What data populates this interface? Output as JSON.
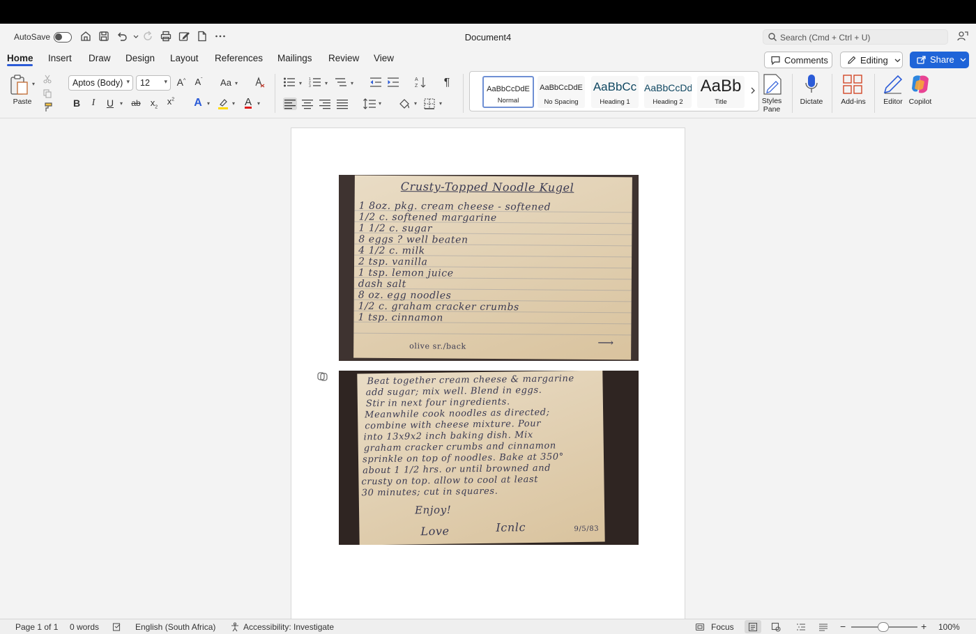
{
  "titlebar": {
    "autosave_label": "AutoSave",
    "autosave_on": false,
    "document_title": "Document4",
    "search_placeholder": "Search (Cmd + Ctrl + U)"
  },
  "tabs": [
    "Home",
    "Insert",
    "Draw",
    "Design",
    "Layout",
    "References",
    "Mailings",
    "Review",
    "View"
  ],
  "active_tab": "Home",
  "header_buttons": {
    "comments": "Comments",
    "editing": "Editing",
    "share": "Share"
  },
  "ribbon": {
    "paste_label": "Paste",
    "font_name": "Aptos (Body)",
    "font_size": "12",
    "case_label": "Aa",
    "grow_font": "A",
    "shrink_font": "A",
    "bold": "B",
    "italic": "I",
    "underline": "U",
    "strike": "ab",
    "subscript": "x",
    "superscript": "x",
    "text_effects": "A",
    "font_color": "A",
    "pilcrow": "¶",
    "styles": [
      {
        "preview": "AaBbCcDdE",
        "name": "Normal",
        "selected": true
      },
      {
        "preview": "AaBbCcDdE",
        "name": "No Spacing",
        "selected": false
      },
      {
        "preview": "AaBbCc",
        "name": "Heading 1",
        "selected": false
      },
      {
        "preview": "AaBbCcDd",
        "name": "Heading 2",
        "selected": false
      },
      {
        "preview": "AaBb",
        "name": "Title",
        "selected": false
      }
    ],
    "styles_pane_line1": "Styles",
    "styles_pane_line2": "Pane",
    "dictate": "Dictate",
    "addins": "Add-ins",
    "editor": "Editor",
    "copilot": "Copilot"
  },
  "document": {
    "recipe_front": {
      "title": "Crusty-Topped Noodle Kugel",
      "lines": [
        "1 8oz. pkg. cream cheese - softened",
        "1/2 c. softened margarine",
        "1 1/2 c. sugar",
        "8 eggs ? well beaten",
        "4 1/2 c. milk",
        "2 tsp. vanilla",
        "1 tsp. lemon juice",
        "dash salt",
        "8 oz. egg noodles",
        "1/2 c. graham cracker crumbs",
        "1 tsp. cinnamon"
      ],
      "footer": "olive sr./back",
      "arrow": "⟶"
    },
    "recipe_back": {
      "lines": [
        "Beat together cream cheese & margarine",
        "add sugar; mix well. Blend in eggs.",
        "Stir in next four ingredients.",
        "Meanwhile cook noodles as directed;",
        "combine with cheese mixture. Pour",
        "into 13x9x2 inch baking dish. Mix",
        "graham cracker crumbs and cinnamon",
        "sprinkle on top of noodles. Bake at 350°",
        "about 1 1/2 hrs. or until browned and",
        "crusty on top. allow to cool at least",
        "30 minutes; cut in squares."
      ],
      "closing": "Enjoy!",
      "sign_off": "Love",
      "signature": "Icnlc",
      "date": "9/5/83"
    }
  },
  "statusbar": {
    "page": "Page 1 of 1",
    "words": "0 words",
    "language": "English (South Africa)",
    "accessibility": "Accessibility: Investigate",
    "focus": "Focus",
    "zoom": "100%",
    "zoom_level_percent": 100
  },
  "colors": {
    "accent": "#1f64d8",
    "tab_underline": "#2b5bd7",
    "highlight": "#ffd800",
    "font_color": "#e01b1b"
  }
}
